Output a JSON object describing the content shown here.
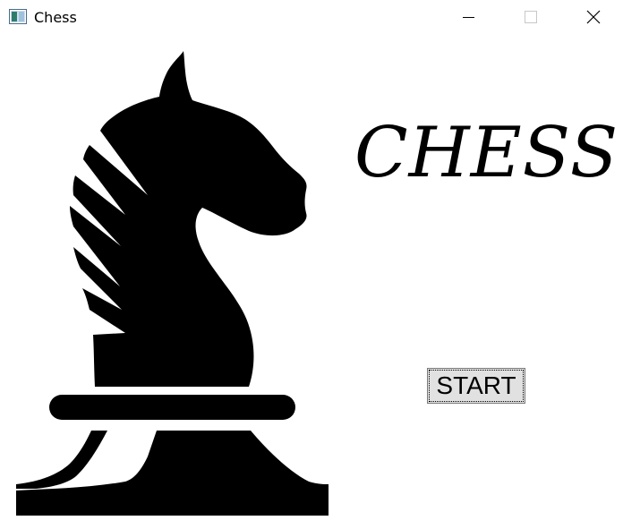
{
  "window": {
    "title": "Chess",
    "icon": "app-window-icon",
    "controls": [
      "minimize-icon",
      "maximize-icon",
      "close-icon"
    ]
  },
  "main": {
    "heading": "CHESS",
    "start_label": "START",
    "graphic": "chess-knight-icon"
  },
  "colors": {
    "background": "#ffffff",
    "piece": "#000000",
    "button_face": "#e1e1e1",
    "button_border": "#7a7a7a"
  }
}
